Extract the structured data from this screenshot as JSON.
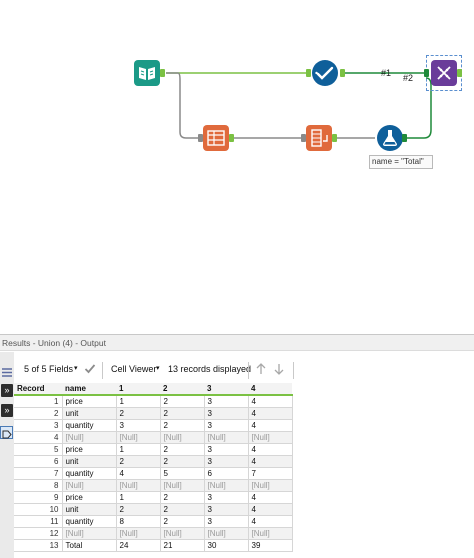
{
  "canvas": {
    "connection_labels": {
      "c1": "#1",
      "c2": "#2"
    },
    "formula_annotation": "name = \"Total\""
  },
  "results": {
    "title": "Results - Union (4) - Output",
    "fields_label": "5 of 5 Fields",
    "viewer_label": "Cell Viewer",
    "records_label": "13 records displayed",
    "columns": [
      "Record",
      "name",
      "1",
      "2",
      "3",
      "4"
    ],
    "rows": [
      [
        "1",
        "price",
        "1",
        "2",
        "3",
        "4"
      ],
      [
        "2",
        "unit",
        "2",
        "2",
        "3",
        "4"
      ],
      [
        "3",
        "quantity",
        "3",
        "2",
        "3",
        "4"
      ],
      [
        "4",
        "[Null]",
        "[Null]",
        "[Null]",
        "[Null]",
        "[Null]"
      ],
      [
        "5",
        "price",
        "1",
        "2",
        "3",
        "4"
      ],
      [
        "6",
        "unit",
        "2",
        "2",
        "3",
        "4"
      ],
      [
        "7",
        "quantity",
        "4",
        "5",
        "6",
        "7"
      ],
      [
        "8",
        "[Null]",
        "[Null]",
        "[Null]",
        "[Null]",
        "[Null]"
      ],
      [
        "9",
        "price",
        "1",
        "2",
        "3",
        "4"
      ],
      [
        "10",
        "unit",
        "2",
        "2",
        "3",
        "4"
      ],
      [
        "11",
        "quantity",
        "8",
        "2",
        "3",
        "4"
      ],
      [
        "12",
        "[Null]",
        "[Null]",
        "[Null]",
        "[Null]",
        "[Null]"
      ],
      [
        "13",
        "Total",
        "24",
        "21",
        "30",
        "39"
      ]
    ]
  },
  "icons": {
    "input": "book-icon",
    "select": "checkmark-icon",
    "crosstab": "table-icon",
    "transpose": "transpose-icon",
    "formula": "flask-icon",
    "union": "dna-icon"
  },
  "colors": {
    "accent_green": "#7bc143",
    "input_teal": "#1b9a87",
    "select_blue": "#0f5f9a",
    "transform_orange": "#e06a3c",
    "union_purple": "#6a3c9a"
  }
}
